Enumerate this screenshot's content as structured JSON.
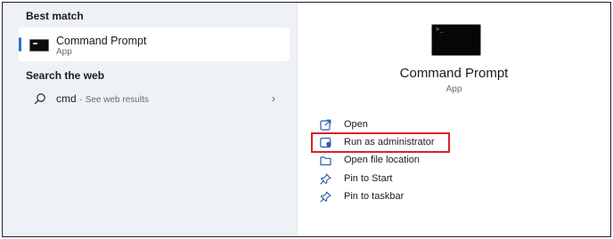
{
  "left_panel": {
    "best_match_title": "Best match",
    "best_match_item": {
      "name": "Command Prompt",
      "type": "App",
      "icon": "command-prompt-icon"
    },
    "web_title": "Search the web",
    "web_item": {
      "query": "cmd",
      "separator": "-",
      "hint": "See web results",
      "icon": "search-icon",
      "chevron": "›"
    }
  },
  "right_panel": {
    "app_name": "Command Prompt",
    "app_type": "App",
    "actions": [
      {
        "label": "Open",
        "icon": "open-icon"
      },
      {
        "label": "Run as administrator",
        "icon": "shield-icon"
      },
      {
        "label": "Open file location",
        "icon": "folder-icon"
      },
      {
        "label": "Pin to Start",
        "icon": "pin-icon"
      },
      {
        "label": "Pin to taskbar",
        "icon": "pin-icon"
      }
    ]
  },
  "colors": {
    "accent": "#2f6fd6",
    "highlight": "#e01f26",
    "left_panel_bg": "#eef2f7"
  }
}
